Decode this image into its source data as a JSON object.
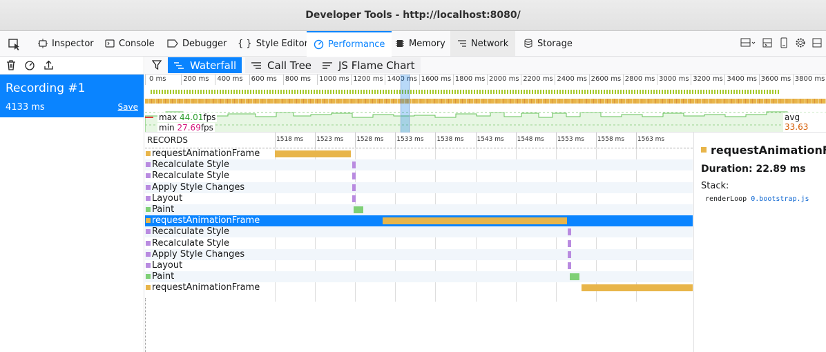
{
  "window": {
    "title": "Developer Tools - http://localhost:8080/"
  },
  "tabs": [
    {
      "label": "Inspector",
      "icon": "inspector-icon"
    },
    {
      "label": "Console",
      "icon": "console-icon"
    },
    {
      "label": "Debugger",
      "icon": "debugger-icon"
    },
    {
      "label": "Style Editor",
      "icon": "style-editor-icon"
    },
    {
      "label": "Performance",
      "icon": "performance-icon",
      "active": true
    },
    {
      "label": "Memory",
      "icon": "memory-icon"
    },
    {
      "label": "Network",
      "icon": "network-icon"
    },
    {
      "label": "Storage",
      "icon": "storage-icon"
    }
  ],
  "views": {
    "waterfall": "Waterfall",
    "calltree": "Call Tree",
    "flame": "JS Flame Chart"
  },
  "recording": {
    "name": "Recording #1",
    "duration": "4133 ms",
    "save": "Save"
  },
  "overview": {
    "ticks": [
      "0 ms",
      "200 ms",
      "400 ms",
      "600 ms",
      "800 ms",
      "1000 ms",
      "1200 ms",
      "1400 ms",
      "1600 ms",
      "1800 ms",
      "2000 ms",
      "2200 ms",
      "2400 ms",
      "2600 ms",
      "2800 ms",
      "3000 ms",
      "3200 ms",
      "3400 ms",
      "3600 ms",
      "3800 ms"
    ],
    "fps": {
      "max_label": "max",
      "max": "44.01",
      "min_label": "min",
      "min": "27.69",
      "avg_label": "avg",
      "avg": "33.63",
      "unit": "fps"
    }
  },
  "waterfall": {
    "header": "RECORDS",
    "ticks": [
      "1518 ms",
      "1523 ms",
      "1528 ms",
      "1533 ms",
      "1538 ms",
      "1543 ms",
      "1548 ms",
      "1553 ms",
      "1558 ms",
      "1563 ms"
    ],
    "rows": [
      {
        "name": "requestAnimationFrame",
        "kind": "js",
        "start": 0,
        "end": 110
      },
      {
        "name": "Recalculate Style",
        "kind": "style",
        "start": 112,
        "end": 117
      },
      {
        "name": "Recalculate Style",
        "kind": "style",
        "start": 112,
        "end": 117
      },
      {
        "name": "Apply Style Changes",
        "kind": "style",
        "start": 112,
        "end": 117
      },
      {
        "name": "Layout",
        "kind": "style",
        "start": 112,
        "end": 117
      },
      {
        "name": "Paint",
        "kind": "paint",
        "start": 114,
        "end": 128
      },
      {
        "name": "requestAnimationFrame",
        "kind": "js",
        "start": 156,
        "end": 423,
        "selected": true
      },
      {
        "name": "Recalculate Style",
        "kind": "style",
        "start": 424,
        "end": 429
      },
      {
        "name": "Recalculate Style",
        "kind": "style",
        "start": 424,
        "end": 429
      },
      {
        "name": "Apply Style Changes",
        "kind": "style",
        "start": 424,
        "end": 429
      },
      {
        "name": "Layout",
        "kind": "style",
        "start": 424,
        "end": 429
      },
      {
        "name": "Paint",
        "kind": "paint",
        "start": 427,
        "end": 441
      },
      {
        "name": "requestAnimationFrame",
        "kind": "js",
        "start": 444,
        "end": 605
      }
    ]
  },
  "colors": {
    "js": "#e8b54a",
    "style": "#b98be0",
    "paint": "#7fd076",
    "accent": "#0a84ff"
  },
  "details": {
    "name": "requestAnimationFrame",
    "duration": "Duration: 22.89 ms",
    "stack_label": "Stack:",
    "frame_fn": "renderLoop",
    "frame_src": "0.bootstrap.js"
  }
}
